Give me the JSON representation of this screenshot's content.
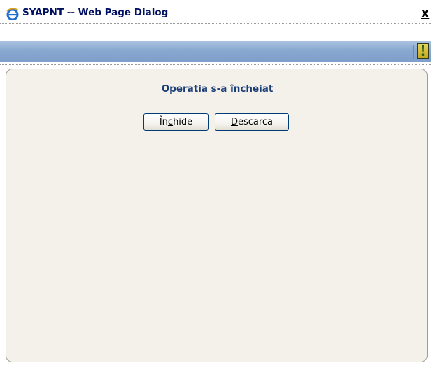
{
  "window": {
    "title": "SYAPNT -- Web Page Dialog",
    "close_label": "X"
  },
  "toolbar": {
    "alert_icon": "exclamation-icon",
    "alert_color": "#c5a81e"
  },
  "content": {
    "message": "Operatia s-a încheiat",
    "buttons": {
      "close": {
        "pre": "În",
        "accel": "c",
        "post": "hide"
      },
      "download": {
        "pre": "",
        "accel": "D",
        "post": "escarca"
      }
    }
  },
  "colors": {
    "title_text": "#001060",
    "toolbar_bg": "#89a8d0",
    "panel_bg": "#f3f1ea",
    "message_text": "#1a3d78",
    "button_border": "#003c74"
  }
}
